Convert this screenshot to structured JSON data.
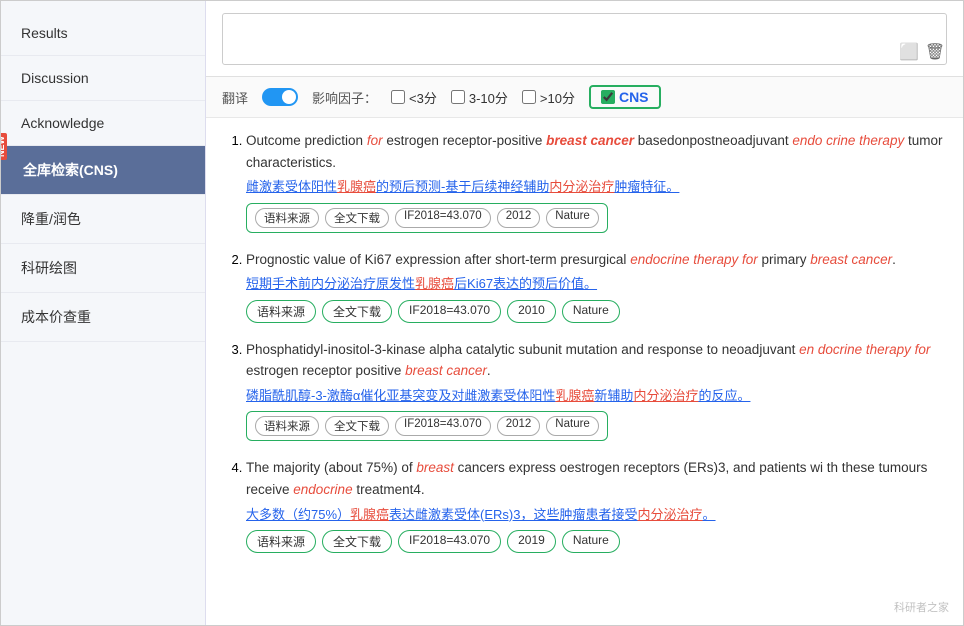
{
  "sidebar": {
    "items": [
      {
        "label": "Results",
        "active": false,
        "id": "results"
      },
      {
        "label": "Discussion",
        "active": false,
        "id": "discussion"
      },
      {
        "label": "Acknowledge",
        "active": false,
        "id": "acknowledge"
      },
      {
        "label": "全库检索(CNS)",
        "active": true,
        "id": "cns-search",
        "badge": "NEW"
      },
      {
        "label": "降重/润色",
        "active": false,
        "id": "rewrite"
      },
      {
        "label": "科研绘图",
        "active": false,
        "id": "drawing"
      },
      {
        "label": "成本价查重",
        "active": false,
        "id": "plagiarism"
      }
    ]
  },
  "filter": {
    "translate_label": "翻译",
    "impact_label": "影响因子：",
    "options": [
      "<3分",
      "3-10分",
      ">10分"
    ],
    "cns_label": "CNS"
  },
  "results": [
    {
      "num": 1,
      "title_parts": [
        {
          "text": "Outcome prediction ",
          "style": "normal"
        },
        {
          "text": "for",
          "style": "italic-red"
        },
        {
          "text": " estrogen receptor-positive ",
          "style": "normal"
        },
        {
          "text": "breast cancer",
          "style": "bold-red"
        },
        {
          "text": " basedonpostneoadjuvant ",
          "style": "normal"
        },
        {
          "text": "endo crine therapy",
          "style": "italic-red"
        },
        {
          "text": " tumor characteristics.",
          "style": "normal"
        }
      ],
      "cn_text": "雌激素受体阳性乳腺癌的预后预测-基于后续神经辅助内分泌治疗肿瘤特征。",
      "cn_red_parts": [
        "乳腺癌",
        "内分泌治疗"
      ],
      "tags": [
        "语料来源",
        "全文下载",
        "IF2018=43.070",
        "2012",
        "Nature"
      ],
      "tagged_border": true
    },
    {
      "num": 2,
      "title_parts": [
        {
          "text": "Prognostic value of Ki67 expression after short-term presurgical ",
          "style": "normal"
        },
        {
          "text": "endocrine therapy for",
          "style": "italic-red"
        },
        {
          "text": " primary ",
          "style": "normal"
        },
        {
          "text": "breast cancer",
          "style": "italic-red"
        },
        {
          "text": ".",
          "style": "normal"
        }
      ],
      "cn_text": "短期手术前内分泌治疗原发性乳腺癌后Ki67表达的预后价值。",
      "cn_red_parts": [
        "乳腺癌"
      ],
      "tags": [
        "语料来源",
        "全文下载",
        "IF2018=43.070",
        "2010",
        "Nature"
      ],
      "tagged_border": false
    },
    {
      "num": 3,
      "title_parts": [
        {
          "text": "Phosphatidyl-inositol-3-kinase alpha catalytic subunit mutation and response to neoadjuvant ",
          "style": "normal"
        },
        {
          "text": "en docrine therapy for",
          "style": "italic-red"
        },
        {
          "text": " estrogen receptor positive ",
          "style": "normal"
        },
        {
          "text": "breast cancer",
          "style": "italic-red"
        },
        {
          "text": ".",
          "style": "normal"
        }
      ],
      "cn_text": "磷脂酰肌醇-3-激酶α催化亚基突变及对雌激素受体阳性乳腺癌新辅助内分泌治疗的反应。",
      "cn_red_parts": [
        "乳腺癌",
        "内分泌治疗"
      ],
      "tags": [
        "语料来源",
        "全文下载",
        "IF2018=43.070",
        "2012",
        "Nature"
      ],
      "tagged_border": true
    },
    {
      "num": 4,
      "title_parts": [
        {
          "text": "The majority (about 75%) of ",
          "style": "normal"
        },
        {
          "text": "breast",
          "style": "italic-red"
        },
        {
          "text": " cancers express oestrogen receptors (ERs)3, and patients wi th these tumours receive ",
          "style": "normal"
        },
        {
          "text": "endocrine",
          "style": "italic-red"
        },
        {
          "text": " treatment4.",
          "style": "normal"
        }
      ],
      "cn_text": "大多数（约75%）乳腺癌表达雌激素受体(ERs)3，这些肿瘤患者接受内分泌治疗。",
      "cn_red_parts": [
        "乳腺癌",
        "内分泌治疗"
      ],
      "tags": [
        "语料来源",
        "全文下载",
        "IF2018=43.070",
        "2019",
        "Nature"
      ],
      "tagged_border": false
    }
  ],
  "watermark": "科研者之家"
}
